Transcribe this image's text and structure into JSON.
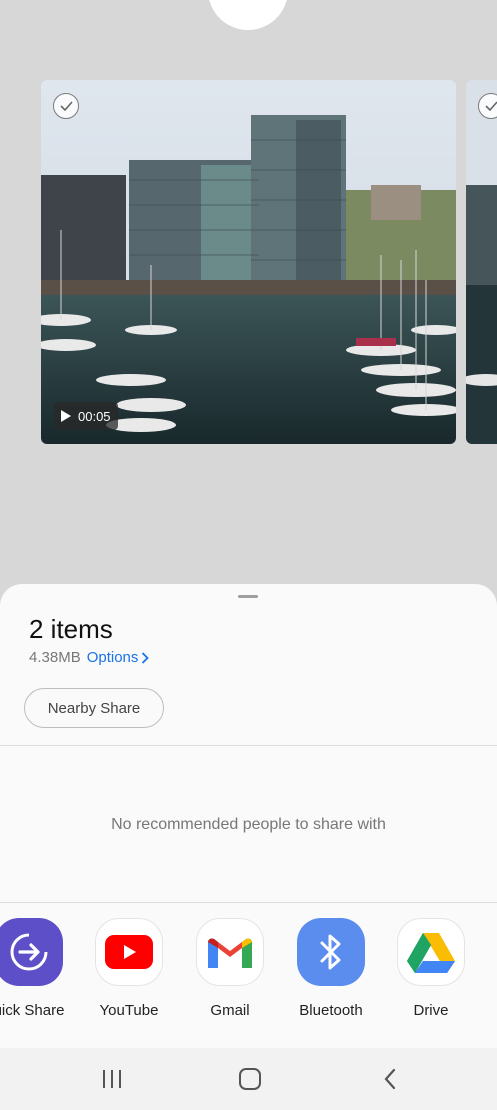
{
  "preview": {
    "video_duration": "00:05"
  },
  "share_sheet": {
    "title": "2 items",
    "size": "4.38MB",
    "options_label": "Options",
    "nearby_share_label": "Nearby Share",
    "no_recommendations_text": "No recommended people to share with",
    "apps": [
      {
        "label": "uick Share",
        "icon": "quick-share-icon",
        "color": "#6b5bd2"
      },
      {
        "label": "YouTube",
        "icon": "youtube-icon",
        "color": "#ff0000"
      },
      {
        "label": "Gmail",
        "icon": "gmail-icon",
        "color": "#ea4335"
      },
      {
        "label": "Bluetooth",
        "icon": "bluetooth-icon",
        "color": "#5b8def"
      },
      {
        "label": "Drive",
        "icon": "drive-icon",
        "color": "#1fa463"
      }
    ]
  },
  "nav_bar": {
    "recents": "recents-icon",
    "home": "home-icon",
    "back": "back-icon"
  },
  "colors": {
    "accent": "#1a73e8",
    "background": "#d7d7d7",
    "sheet": "#fafafa"
  }
}
